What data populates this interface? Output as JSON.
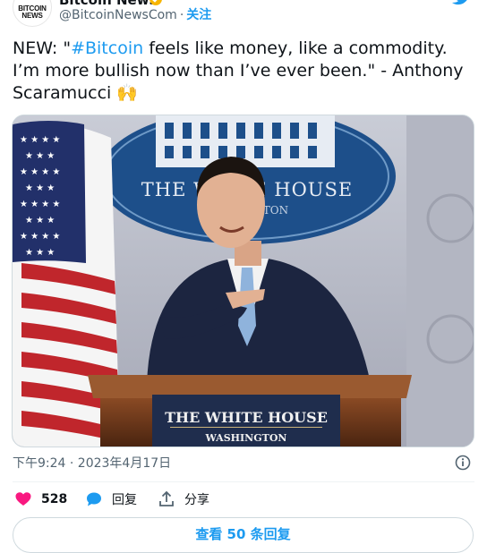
{
  "account": {
    "avatar_text": "BITCOIN\nNEWS",
    "display_name": "Bitcoin News",
    "handle": "@BitcoinNewsCom",
    "separator": "·",
    "follow_label": "关注"
  },
  "tweet": {
    "prefix": "NEW: \"",
    "hashtag": "#Bitcoin",
    "body": "  feels like money, like a commodity. I’m more bullish now than I’ve ever been.\" - Anthony Scaramucci ",
    "emoji": "🙌"
  },
  "image": {
    "seal_text": "THE WHITE HOUSE",
    "seal_sub": "WASHINGTON",
    "podium_title": "THE WHITE HOUSE",
    "podium_sub": "WASHINGTON"
  },
  "timestamp": "下午9:24 · 2023年4月17日",
  "actions": {
    "likes": "528",
    "reply_label": "回复",
    "share_label": "分享"
  },
  "more_replies_label": "查看 50 条回复",
  "colors": {
    "accent": "#1d9bf0",
    "like": "#f91880",
    "text": "#0f1419",
    "muted": "#536471"
  },
  "icons": [
    "bitcoin-news-logo",
    "verified-badge-icon",
    "twitter-bird-icon",
    "heart-icon",
    "reply-bubble-icon",
    "share-icon",
    "info-icon"
  ]
}
